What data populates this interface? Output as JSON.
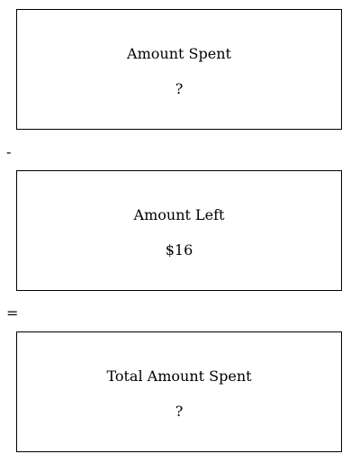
{
  "boxes": [
    {
      "title": "Amount Spent",
      "value": "?"
    },
    {
      "title": "Amount Left",
      "value": "$16"
    },
    {
      "title": "Total Amount Spent",
      "value": "?"
    }
  ],
  "operators": [
    "-",
    "="
  ],
  "colors": {
    "border": "#000000",
    "background": "#ffffff",
    "text": "#000000"
  }
}
